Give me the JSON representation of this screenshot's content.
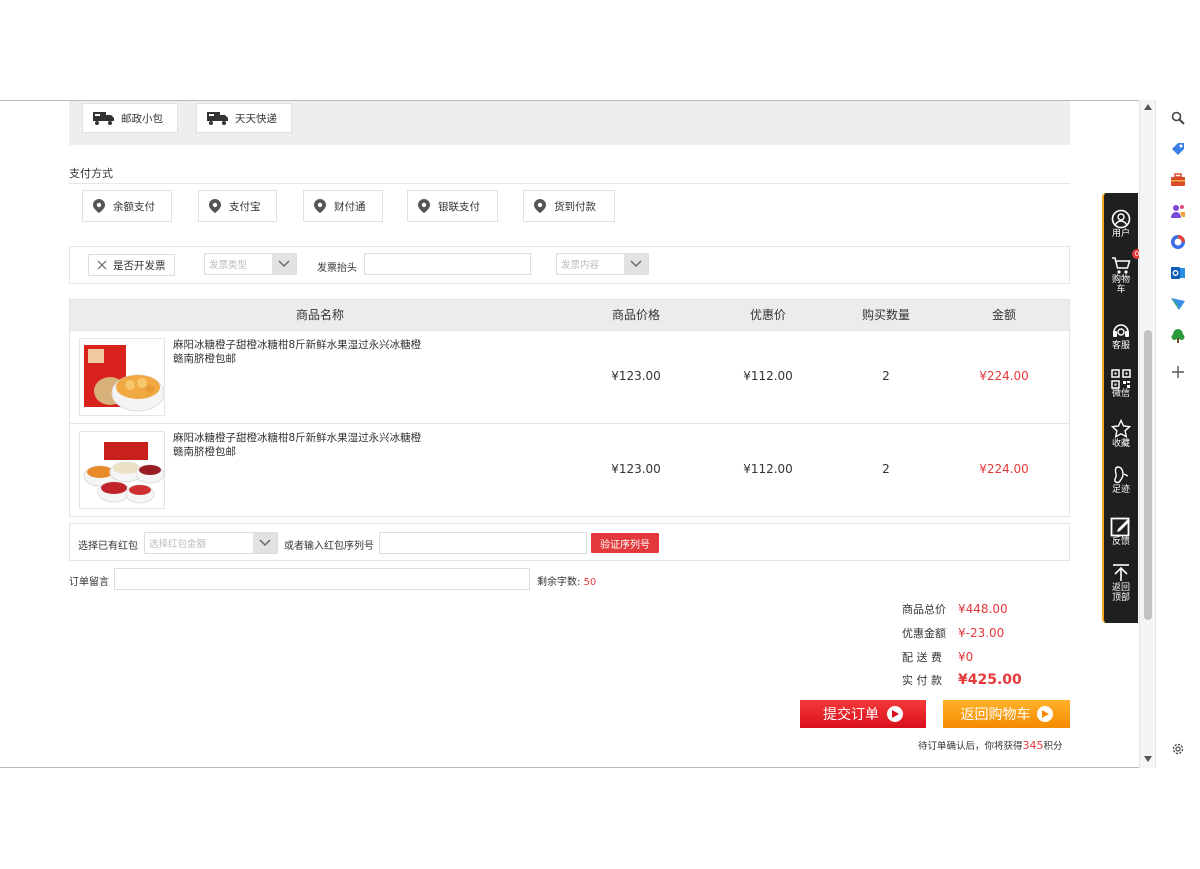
{
  "shipping": {
    "options": [
      "邮政小包",
      "天天快递"
    ]
  },
  "payment": {
    "title": "支付方式",
    "options": [
      "余额支付",
      "支付宝",
      "财付通",
      "银联支付",
      "货到付款"
    ]
  },
  "invoice": {
    "toggle_label": "是否开发票",
    "type_placeholder": "发票类型",
    "title_label": "发票抬头",
    "content_placeholder": "发票内容"
  },
  "table": {
    "headers": [
      "商品名称",
      "商品价格",
      "优惠价",
      "购买数量",
      "金额"
    ],
    "rows": [
      {
        "name": "麻阳冰糖橙子甜橙冰糖柑8斤新鲜水果湿过永兴冰糖橙赣南脐橙包邮",
        "price": "¥123.00",
        "discount": "¥112.00",
        "qty": "2",
        "amount": "¥224.00"
      },
      {
        "name": "麻阳冰糖橙子甜橙冰糖柑8斤新鲜水果湿过永兴冰糖橙赣南脐橙包邮",
        "price": "¥123.00",
        "discount": "¥112.00",
        "qty": "2",
        "amount": "¥224.00"
      }
    ]
  },
  "packet": {
    "label": "选择已有红包",
    "select_placeholder": "选择红包金额",
    "or_label": "或者输入红包序列号",
    "verify_button": "验证序列号"
  },
  "remark": {
    "label": "订单留言",
    "remaining_label": "剩余字数:",
    "remaining_count": "50"
  },
  "summary": {
    "total_label": "商品总价",
    "total_value": "¥448.00",
    "discount_label": "优惠金额",
    "discount_value": "¥-23.00",
    "shipping_label": "配 送 费",
    "shipping_value": "¥0",
    "pay_label": "实 付 款",
    "pay_value": "¥425.00"
  },
  "actions": {
    "submit": "提交订单",
    "back": "返回购物车",
    "points_prefix": "待订单确认后，你将获得",
    "points_value": "345",
    "points_suffix": "积分"
  },
  "toolbar": {
    "user": "用户",
    "cart": "购物车",
    "cart_count": "0",
    "service": "客服",
    "wechat": "微信",
    "favorite": "收藏",
    "history": "足迹",
    "feedback": "反馈",
    "top": "返回顶部"
  },
  "colors": {
    "accent_red": "#e4393c",
    "accent_orange": "#f58a00",
    "toolbar_bg": "#1f1f1f"
  }
}
